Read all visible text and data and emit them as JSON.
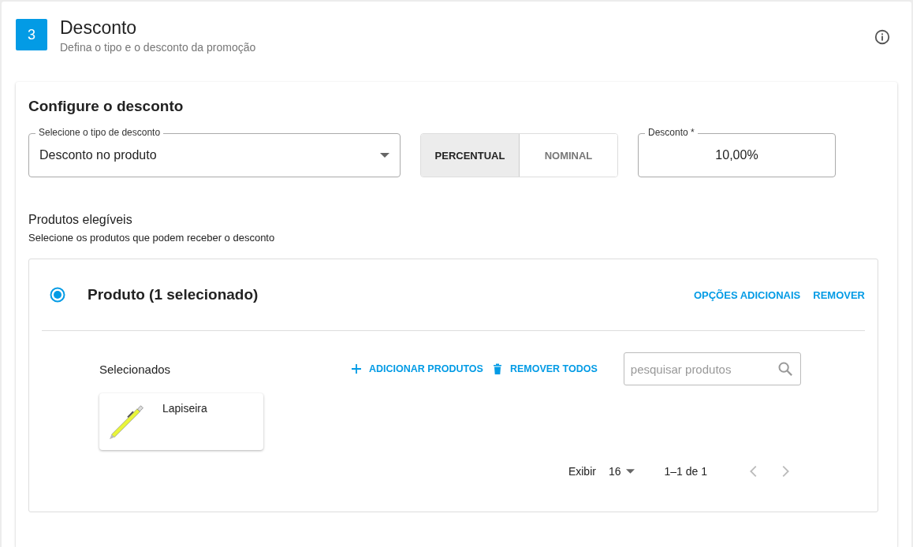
{
  "step": {
    "number": "3",
    "title": "Desconto",
    "subtitle": "Defina o tipo e o desconto da promoção"
  },
  "config": {
    "title": "Configure o desconto",
    "type_select": {
      "label": "Selecione o tipo de desconto",
      "value": "Desconto no produto"
    },
    "mode_toggle": [
      {
        "label": "PERCENTUAL",
        "selected": true
      },
      {
        "label": "NOMINAL",
        "selected": false
      }
    ],
    "discount_field": {
      "label": "Desconto *",
      "value": "10,00%"
    },
    "eligible": {
      "title": "Produtos elegíveis",
      "description": "Selecione os produtos que podem receber o desconto"
    },
    "product_group": {
      "title": "Produto (1 selecionado)",
      "selected": true,
      "actions": [
        "OPÇÕES ADICIONAIS",
        "REMOVER"
      ],
      "selected_label": "Selecionados",
      "add_button": "ADICIONAR PRODUTOS",
      "remove_all_button": "REMOVER TODOS",
      "search": {
        "placeholder": "pesquisar produtos"
      },
      "products": [
        {
          "name": "Lapiseira"
        }
      ],
      "pagination": {
        "show_label": "Exibir",
        "page_size": "16",
        "range": "1–1 de 1",
        "prev_disabled": true,
        "next_disabled": true
      }
    }
  }
}
